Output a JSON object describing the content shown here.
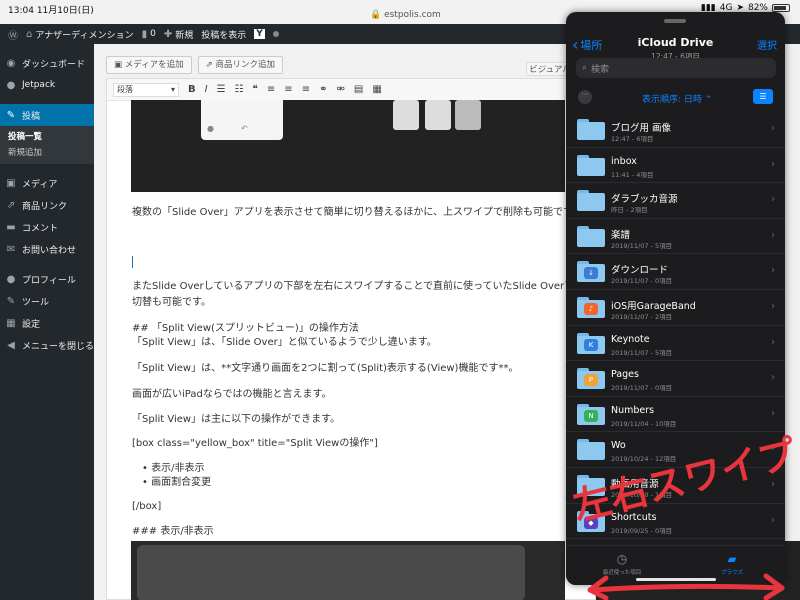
{
  "status_bar": {
    "time": "13:04",
    "date": "11月10日(日)",
    "domain": "estpolis.com",
    "network": "4G",
    "battery": "82%"
  },
  "admin_bar": {
    "site_name": "アナザーディメンション",
    "comments": "0",
    "new": "新規",
    "view_post": "投稿を表示"
  },
  "sidebar": {
    "dashboard": "ダッシュボード",
    "jetpack": "Jetpack",
    "posts": "投稿",
    "posts_list": "投稿一覧",
    "new_post": "新規追加",
    "media": "メディア",
    "product_link": "商品リンク",
    "comments": "コメント",
    "contact": "お問い合わせ",
    "profile": "プロフィール",
    "tools": "ツール",
    "settings": "設定",
    "collapse": "メニューを閉じる"
  },
  "editor": {
    "add_media": "メディアを追加",
    "add_product_link": "商品リンク追加",
    "visual_tab": "ビジュアル",
    "format_select": "段落",
    "lines": [
      "複数の「Slide Over」アプリを表示させて簡単に切り替えるほかに、上スワイプで削除も可能です。",
      "またSlide Overしているアプリの下部を左右にスワイプすることで直前に使っていたSlide Overアプリへ",
      "切替も可能です。",
      "##  「Split View(スプリットビュー)」の操作方法",
      "「Split View」は、「Slide Over」と似ているようで少し違います。",
      "「Split View」は、**文字通り画面を2つに割って(Split)表示する(View)機能です**。",
      "画面が広いiPadならではの機能と言えます。",
      "「Split View」は主に以下の操作ができます。",
      "[box class=\"yellow_box\" title=\"Split Viewの操作\"]",
      "表示/非表示",
      "画面割合変更",
      "[/box]",
      "### 表示/非表示"
    ]
  },
  "icloud": {
    "back_label": "場所",
    "title": "iCloud Drive",
    "subtitle": "12:47 - 6項目",
    "select": "選択",
    "search_placeholder": "検索",
    "sort_label": "表示順序: 日時",
    "items": [
      {
        "name": "ブログ用 画像",
        "meta": "12:47 - 6項目",
        "badge": ""
      },
      {
        "name": "inbox",
        "meta": "11:41 - 4項目",
        "badge": ""
      },
      {
        "name": "ダラブッカ音源",
        "meta": "昨日 - 2項目",
        "badge": ""
      },
      {
        "name": "楽譜",
        "meta": "2019/11/07 - 5項目",
        "badge": ""
      },
      {
        "name": "ダウンロード",
        "meta": "2019/11/07 - 0項目",
        "badge": "download"
      },
      {
        "name": "iOS用GarageBand",
        "meta": "2019/11/07 - 2項目",
        "badge": "garageband"
      },
      {
        "name": "Keynote",
        "meta": "2019/11/07 - 5項目",
        "badge": "keynote"
      },
      {
        "name": "Pages",
        "meta": "2019/11/07 - 0項目",
        "badge": "pages"
      },
      {
        "name": "Numbers",
        "meta": "2019/11/04 - 10項目",
        "badge": "numbers"
      },
      {
        "name": "Wo",
        "meta": "2019/10/24 - 12項目",
        "badge": ""
      },
      {
        "name": "動画用音源",
        "meta": "2019/10/20 - 1項目",
        "badge": ""
      },
      {
        "name": "Shortcuts",
        "meta": "2019/09/25 - 0項目",
        "badge": "shortcuts"
      }
    ],
    "tab_recent": "最近使った項目",
    "tab_browse": "ブラウズ"
  },
  "annotation": {
    "text": "左右スワイプ",
    "color": "#e8343c"
  },
  "colors": {
    "wp_admin": "#23282d",
    "wp_blue": "#0073aa",
    "ios_blue": "#0a84ff"
  }
}
